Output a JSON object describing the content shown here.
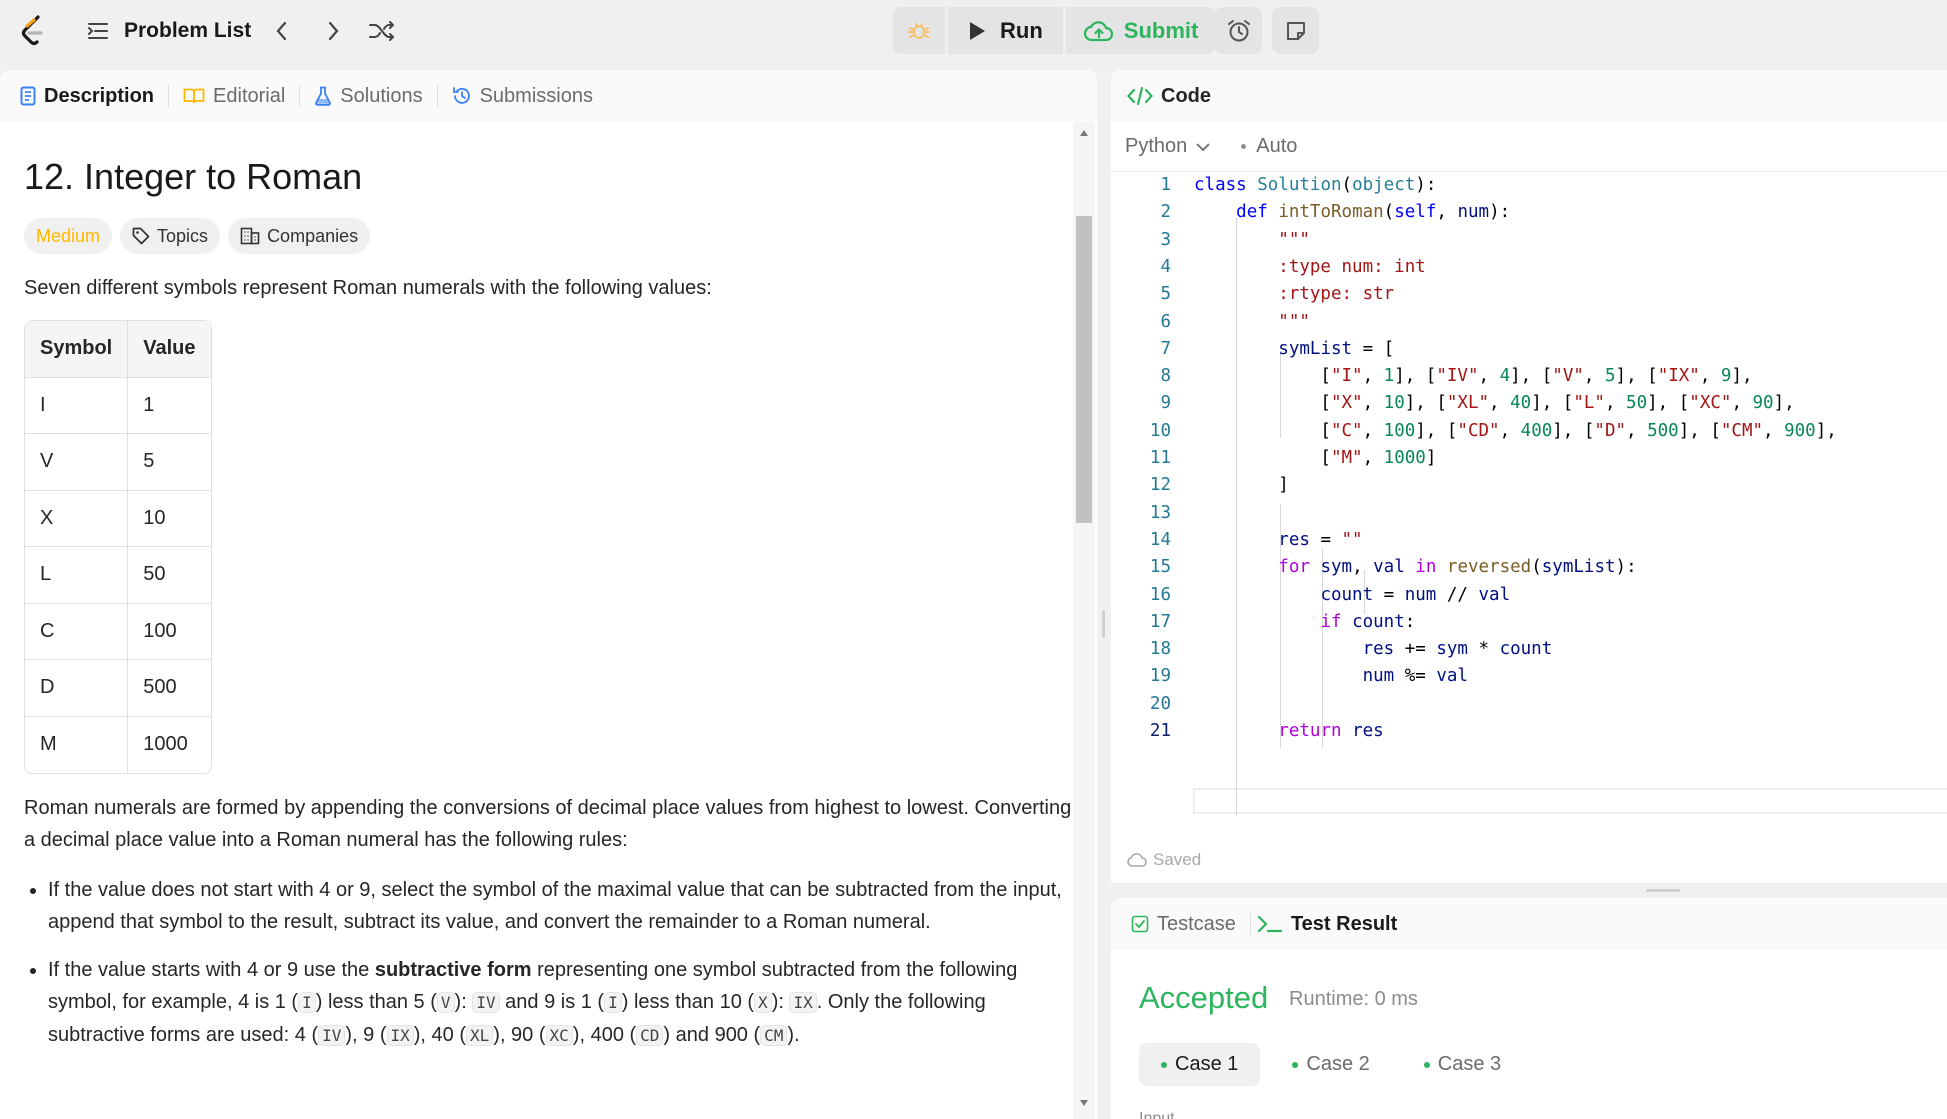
{
  "topbar": {
    "problem_list_label": "Problem List",
    "run_label": "Run",
    "submit_label": "Submit"
  },
  "left_tabs": [
    {
      "label": "Description",
      "icon": "description-icon"
    },
    {
      "label": "Editorial",
      "icon": "book-icon"
    },
    {
      "label": "Solutions",
      "icon": "flask-icon"
    },
    {
      "label": "Submissions",
      "icon": "history-icon"
    }
  ],
  "problem": {
    "title": "12. Integer to Roman",
    "difficulty": "Medium",
    "topics_label": "Topics",
    "companies_label": "Companies",
    "intro": "Seven different symbols represent Roman numerals with the following values:",
    "table_headers": [
      "Symbol",
      "Value"
    ],
    "table_rows": [
      [
        "I",
        "1"
      ],
      [
        "V",
        "5"
      ],
      [
        "X",
        "10"
      ],
      [
        "L",
        "50"
      ],
      [
        "C",
        "100"
      ],
      [
        "D",
        "500"
      ],
      [
        "M",
        "1000"
      ]
    ],
    "para2": "Roman numerals are formed by appending the conversions of decimal place values from highest to lowest. Converting a decimal place value into a Roman numeral has the following rules:",
    "bullet1": "If the value does not start with 4 or 9, select the symbol of the maximal value that can be subtracted from the input, append that symbol to the result, subtract its value, and convert the remainder to a Roman numeral.",
    "bullet2_a": "If the value starts with 4 or 9 use the ",
    "bullet2_bold": "subtractive form",
    "bullet2_b": " representing one symbol subtracted from the following symbol, for example, 4 is 1 (",
    "bullet2_c": ") less than 5 (",
    "bullet2_d": "): ",
    "bullet2_e": " and 9 is 1 (",
    "bullet2_f": ") less than 10 (",
    "bullet2_g": "): ",
    "bullet2_h": ". Only the following subtractive forms are used: 4 (",
    "bullet2_i": "), 9 (",
    "bullet2_j": "), 40 (",
    "bullet2_k": "), 90 (",
    "bullet2_l": "), 400 (",
    "bullet2_m": ") and 900 (",
    "bullet2_n": ").",
    "codes": {
      "I": "I",
      "V": "V",
      "IV": "IV",
      "X": "X",
      "IX": "IX",
      "XL": "XL",
      "XC": "XC",
      "CD": "CD",
      "CM": "CM"
    }
  },
  "code_panel": {
    "title": "Code",
    "language": "Python",
    "auto_label": "Auto",
    "saved_label": "Saved"
  },
  "code_lines": [
    "class Solution(object):",
    "    def intToRoman(self, num):",
    "        \"\"\"",
    "        :type num: int",
    "        :rtype: str",
    "        \"\"\"",
    "        symList = [",
    "            [\"I\", 1], [\"IV\", 4], [\"V\", 5], [\"IX\", 9],",
    "            [\"X\", 10], [\"XL\", 40], [\"L\", 50], [\"XC\", 90],",
    "            [\"C\", 100], [\"CD\", 400], [\"D\", 500], [\"CM\", 900],",
    "            [\"M\", 1000]",
    "        ]",
    "",
    "        res = \"\"",
    "        for sym, val in reversed(symList):",
    "            count = num // val",
    "            if count:",
    "                res += sym * count",
    "                num %= val",
    "",
    "        return res"
  ],
  "result_panel": {
    "testcase_label": "Testcase",
    "test_result_label": "Test Result",
    "status": "Accepted",
    "runtime": "Runtime: 0 ms",
    "cases": [
      "Case 1",
      "Case 2",
      "Case 3"
    ],
    "input_label": "Input"
  },
  "colors": {
    "accepted": "#2db55d",
    "medium": "#ffb800",
    "accent": "#ffa116"
  }
}
